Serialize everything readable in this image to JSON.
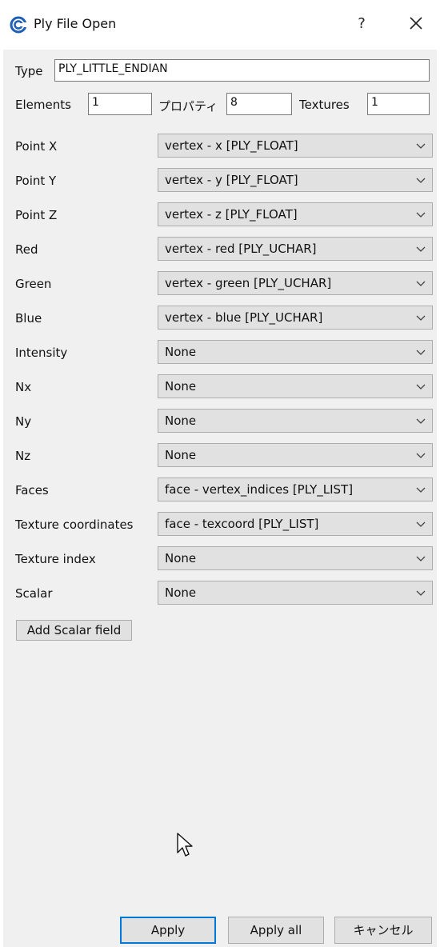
{
  "window": {
    "title": "Ply File Open",
    "help_label": "?",
    "icon": "app-logo-icon",
    "close_icon": "close-icon"
  },
  "header": {
    "type_label": "Type",
    "type_value": "PLY_LITTLE_ENDIAN",
    "elements_label": "Elements",
    "elements_value": "1",
    "properties_label": "プロパティ",
    "properties_value": "8",
    "textures_label": "Textures",
    "textures_value": "1"
  },
  "fields": [
    {
      "label": "Point X",
      "value": "vertex - x [PLY_FLOAT]"
    },
    {
      "label": "Point Y",
      "value": "vertex - y [PLY_FLOAT]"
    },
    {
      "label": "Point Z",
      "value": "vertex - z [PLY_FLOAT]"
    },
    {
      "label": "Red",
      "value": "vertex - red [PLY_UCHAR]"
    },
    {
      "label": "Green",
      "value": "vertex - green [PLY_UCHAR]"
    },
    {
      "label": "Blue",
      "value": "vertex - blue [PLY_UCHAR]"
    },
    {
      "label": "Intensity",
      "value": "None"
    },
    {
      "label": "Nx",
      "value": "None"
    },
    {
      "label": "Ny",
      "value": "None"
    },
    {
      "label": "Nz",
      "value": "None"
    },
    {
      "label": "Faces",
      "value": "face - vertex_indices [PLY_LIST]"
    },
    {
      "label": "Texture coordinates",
      "value": "face - texcoord [PLY_LIST]"
    },
    {
      "label": "Texture index",
      "value": "None"
    },
    {
      "label": "Scalar",
      "value": "None"
    }
  ],
  "add_scalar_label": "Add Scalar field",
  "footer": {
    "apply_label": "Apply",
    "apply_all_label": "Apply all",
    "cancel_label": "キャンセル"
  },
  "colors": {
    "accent": "#0078d7",
    "dialog_bg": "#f0f0f0",
    "combo_bg": "#e1e1e1"
  }
}
